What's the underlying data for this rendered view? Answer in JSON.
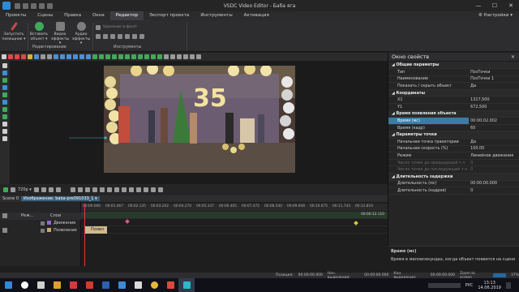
{
  "window": {
    "title": "VSDC Video Editor - Баба яга",
    "minimize": "—",
    "maximize": "☐",
    "close": "✕"
  },
  "menu": {
    "items": [
      "Проекты",
      "Сцены",
      "Правка",
      "Окна",
      "Редактор",
      "Экспорт проекта",
      "Инструменты",
      "Активация"
    ],
    "active": "Редактор",
    "settings": "⚙ Настройки ▾"
  },
  "ribbon": {
    "run_wizard": "Запустить помощник ▾",
    "insert_object": "Вставить объект ▾",
    "video_effects": "Видео эффекты ▾",
    "audio_effects": "Аудио эффекты ▾",
    "group_editing": "Редактирование",
    "crop_label": "Удаление в фон/т",
    "group_tools": "Инструменты"
  },
  "player": {
    "resolution": "720p ▾"
  },
  "scene_tabs": {
    "scene": "Scene 0",
    "object": "Изображение: baba-pre091033_1 ▾"
  },
  "timeline": {
    "head_layer": "Реж...",
    "head_layer2": "Слои",
    "ruler": [
      "00:00:000",
      "00:01.067",
      "00:02.135",
      "00:03.202",
      "00:04.270",
      "00:05.337",
      "00:06.405",
      "00:07.472",
      "00:08.540",
      "00:09.608",
      "00:10.675",
      "00:11.743",
      "00:12.810"
    ],
    "end_time": "00:00:12.110",
    "tracks": [
      "Движение",
      "Появление"
    ],
    "clip_label": "Появл"
  },
  "properties": {
    "title": "Окно свойств",
    "rows": [
      {
        "type": "sec",
        "k": "Общие параметры"
      },
      {
        "k": "Тип",
        "v": "ПозТочки"
      },
      {
        "k": "Наименование",
        "v": "ПозТочки 1"
      },
      {
        "k": "Показать / скрыть объект",
        "v": "Да"
      },
      {
        "type": "sec",
        "k": "Координаты"
      },
      {
        "k": "X1",
        "v": "1317,500"
      },
      {
        "k": "Y1",
        "v": "672,500"
      },
      {
        "type": "sec",
        "k": "Время появления объекта"
      },
      {
        "type": "sel",
        "k": "Время (мс)",
        "v": "00:00:02.002"
      },
      {
        "k": "Время (кадр)",
        "v": "60"
      },
      {
        "type": "sec",
        "k": "Параметры точки"
      },
      {
        "k": "Начальная точка траектории",
        "v": "Да"
      },
      {
        "k": "Начальная скорость (%)",
        "v": "100.00"
      },
      {
        "k": "Режим",
        "v": "Линейное движение"
      },
      {
        "type": "dim",
        "k": "Число точек до предыдущей т.ч",
        "v": "0"
      },
      {
        "type": "dim",
        "k": "Число точек до последующей т.ч",
        "v": "0"
      },
      {
        "type": "sec",
        "k": "Длительность задержки"
      },
      {
        "k": "Длительность (мс)",
        "v": "00:00:00.000"
      },
      {
        "k": "Длительность (кадров)",
        "v": "0"
      }
    ],
    "help_title": "Время (мс)",
    "help_text": "Время в миллисекундах, когда объект появится на сцене"
  },
  "status": {
    "position": "Позиция:",
    "position_val": "00:00:00.000",
    "start_sel": "Нач. выделения:",
    "start_sel_val": "00:00:00.000",
    "end_sel": "Кон. выделения:",
    "end_sel_val": "00:00:00.000",
    "zoom": "Zoom to screen",
    "zoom_pct": "37%"
  },
  "taskbar": {
    "lang": "РУС",
    "time": "13:13",
    "date": "14.06.2019"
  }
}
